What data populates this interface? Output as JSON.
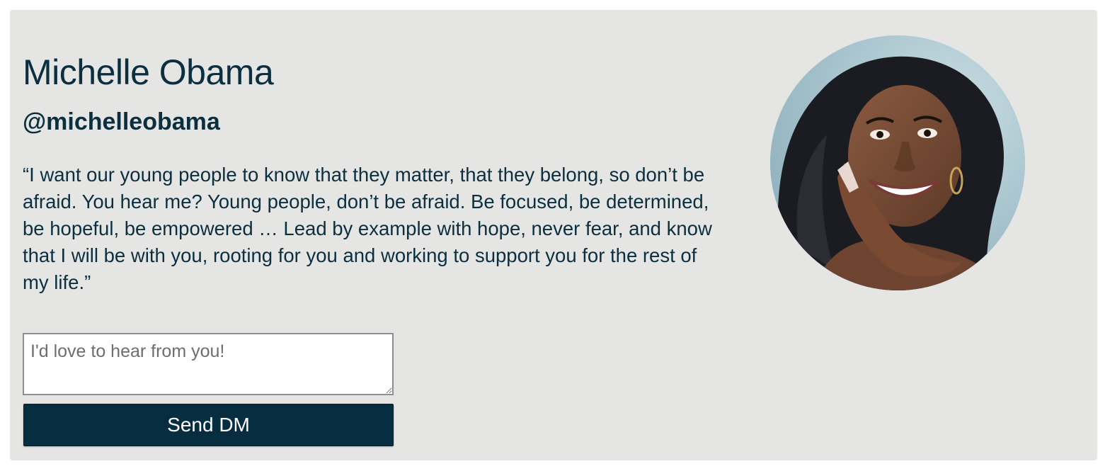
{
  "profile": {
    "name": "Michelle Obama",
    "handle": "@michelleobama",
    "quote": "“I want our young people to know that they matter, that they belong, so don’t be afraid. You hear me? Young people, don’t be afraid. Be focused, be determined, be hopeful, be empowered … Lead by example with hope, never fear, and know that I will be with you, rooting for you and working to support you for the rest of my life.”",
    "avatar_icon": "profile-photo"
  },
  "dm": {
    "placeholder": "I'd love to hear from you!",
    "value": "",
    "send_label": "Send DM"
  },
  "colors": {
    "card_background": "#e5e5e4",
    "text": "#0c2f40",
    "button_background": "#062d40",
    "button_text": "#ffffff"
  }
}
